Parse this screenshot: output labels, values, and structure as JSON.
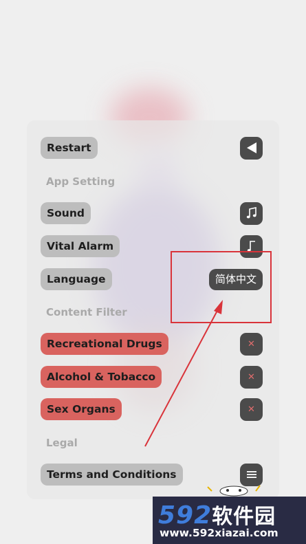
{
  "settings": {
    "restart_label": "Restart",
    "app_setting_header": "App Setting",
    "sound_label": "Sound",
    "vital_alarm_label": "Vital Alarm",
    "language_label": "Language",
    "language_value": "简体中文",
    "content_filter_header": "Content Filter",
    "filters": [
      {
        "label": "Recreational Drugs"
      },
      {
        "label": "Alcohol & Tobacco"
      },
      {
        "label": "Sex Organs"
      }
    ],
    "legal_header": "Legal",
    "terms_label": "Terms and Conditions"
  },
  "icons": {
    "back": "back-arrow-icon",
    "music": "music-note-icon",
    "close": "close-icon",
    "menu": "menu-icon"
  },
  "colors": {
    "pill_gray": "#bdbdbd",
    "pill_red": "#d9635f",
    "icon_button": "#4b4b4b",
    "highlight_red": "#d9333a"
  },
  "watermark": {
    "logo_number": "592",
    "logo_text": "软件园",
    "url": "www.592xiazai.com"
  }
}
